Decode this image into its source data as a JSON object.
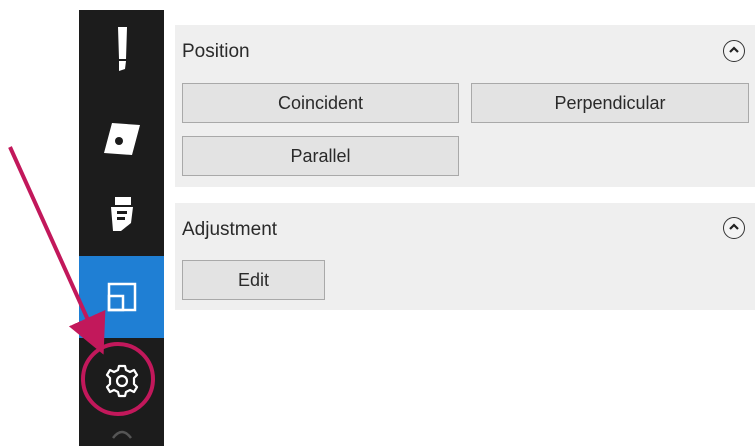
{
  "toolbar": {
    "tools": [
      {
        "icon": "pen-icon",
        "active": false
      },
      {
        "icon": "eraser-icon",
        "active": false
      },
      {
        "icon": "marker-icon",
        "active": false
      },
      {
        "icon": "layout-icon",
        "active": true
      },
      {
        "icon": "gear-icon",
        "active": false
      }
    ]
  },
  "position_panel": {
    "title": "Position",
    "buttons": {
      "coincident": "Coincident",
      "perpendicular": "Perpendicular",
      "parallel": "Parallel"
    }
  },
  "adjustment_panel": {
    "title": "Adjustment",
    "buttons": {
      "edit": "Edit"
    }
  },
  "colors": {
    "toolbar_bg": "#1c1c1c",
    "active_tool": "#1f7fd4",
    "panel_bg": "#efefef",
    "annotation": "#c2185b"
  }
}
